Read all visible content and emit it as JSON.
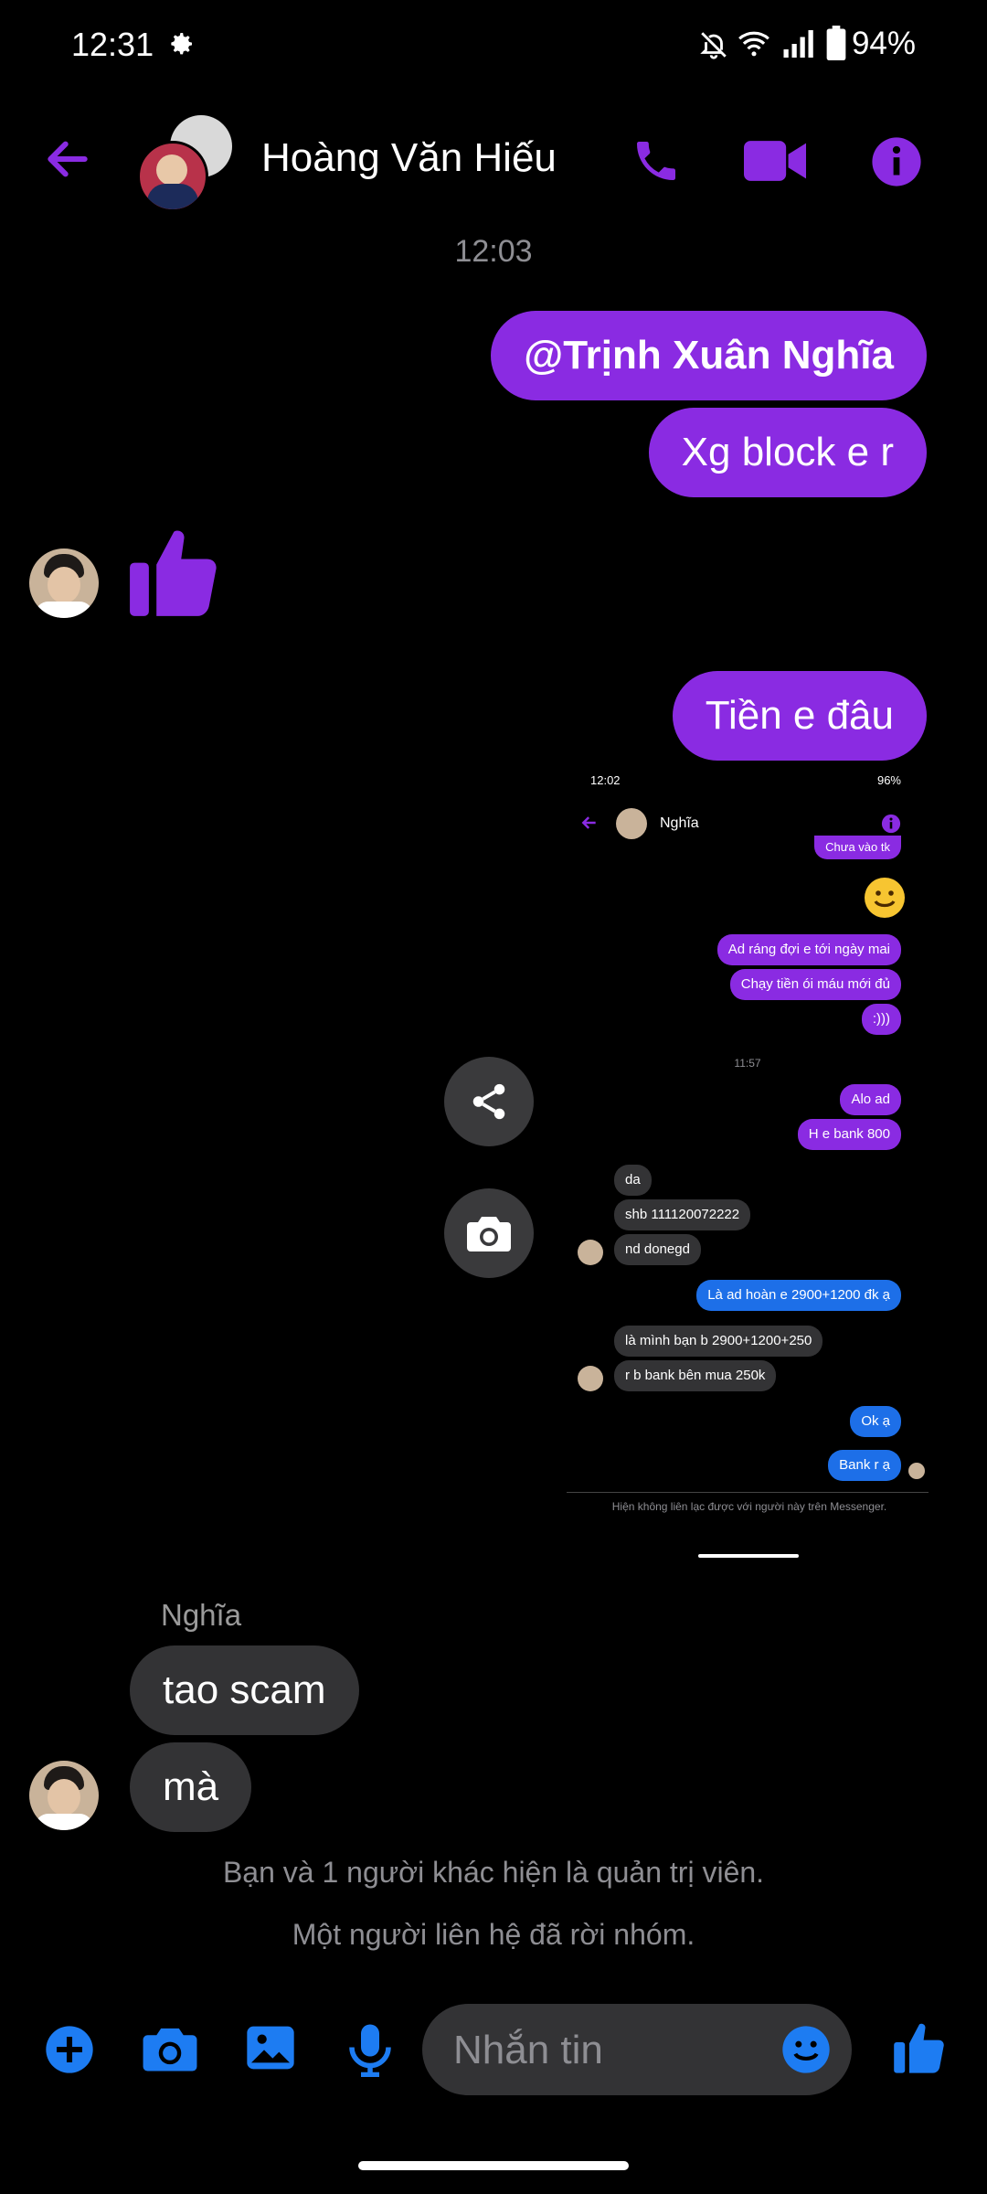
{
  "status_bar": {
    "time": "12:31",
    "battery": "94%"
  },
  "header": {
    "title": "Hoàng Văn Hiếu"
  },
  "messages": {
    "timestamp": "12:03",
    "out1": "@Trịnh Xuân Nghĩa",
    "out2": "Xg block e r",
    "out3": "Tiền e đâu",
    "sender_name": "Nghĩa",
    "in1": "tao scam",
    "in2": "mà",
    "sys1": "Bạn và 1 người khác hiện là quản trị viên.",
    "sys2": "Một người liên hệ đã rời nhóm."
  },
  "screenshot": {
    "time": "12:02",
    "battery": "96%",
    "contact": "Nghĩa",
    "top_cut": "Chưa vào tk",
    "m1": "Ad ráng đợi e tới ngày mai",
    "m2": "Chạy tiền ói máu mới đủ",
    "m3": ":)))",
    "ts": "11:57",
    "m4": "Alo ad",
    "m5": "H e bank 800",
    "m6": "da",
    "m7": "shb 111120072222",
    "m8": "nd donegd",
    "m9": "Là ad hoàn e 2900+1200 đk ạ",
    "m10": "là mình bạn b 2900+1200+250",
    "m11": "r b bank bên mua 250k",
    "m12": "Ok ạ",
    "m13": "Bank r ạ",
    "footer": "Hiện không liên lạc được với người này trên Messenger."
  },
  "composer": {
    "placeholder": "Nhắn tin"
  },
  "colors": {
    "accent": "#8a2be2",
    "blue": "#1d6fe8",
    "in_bubble": "#333335"
  }
}
